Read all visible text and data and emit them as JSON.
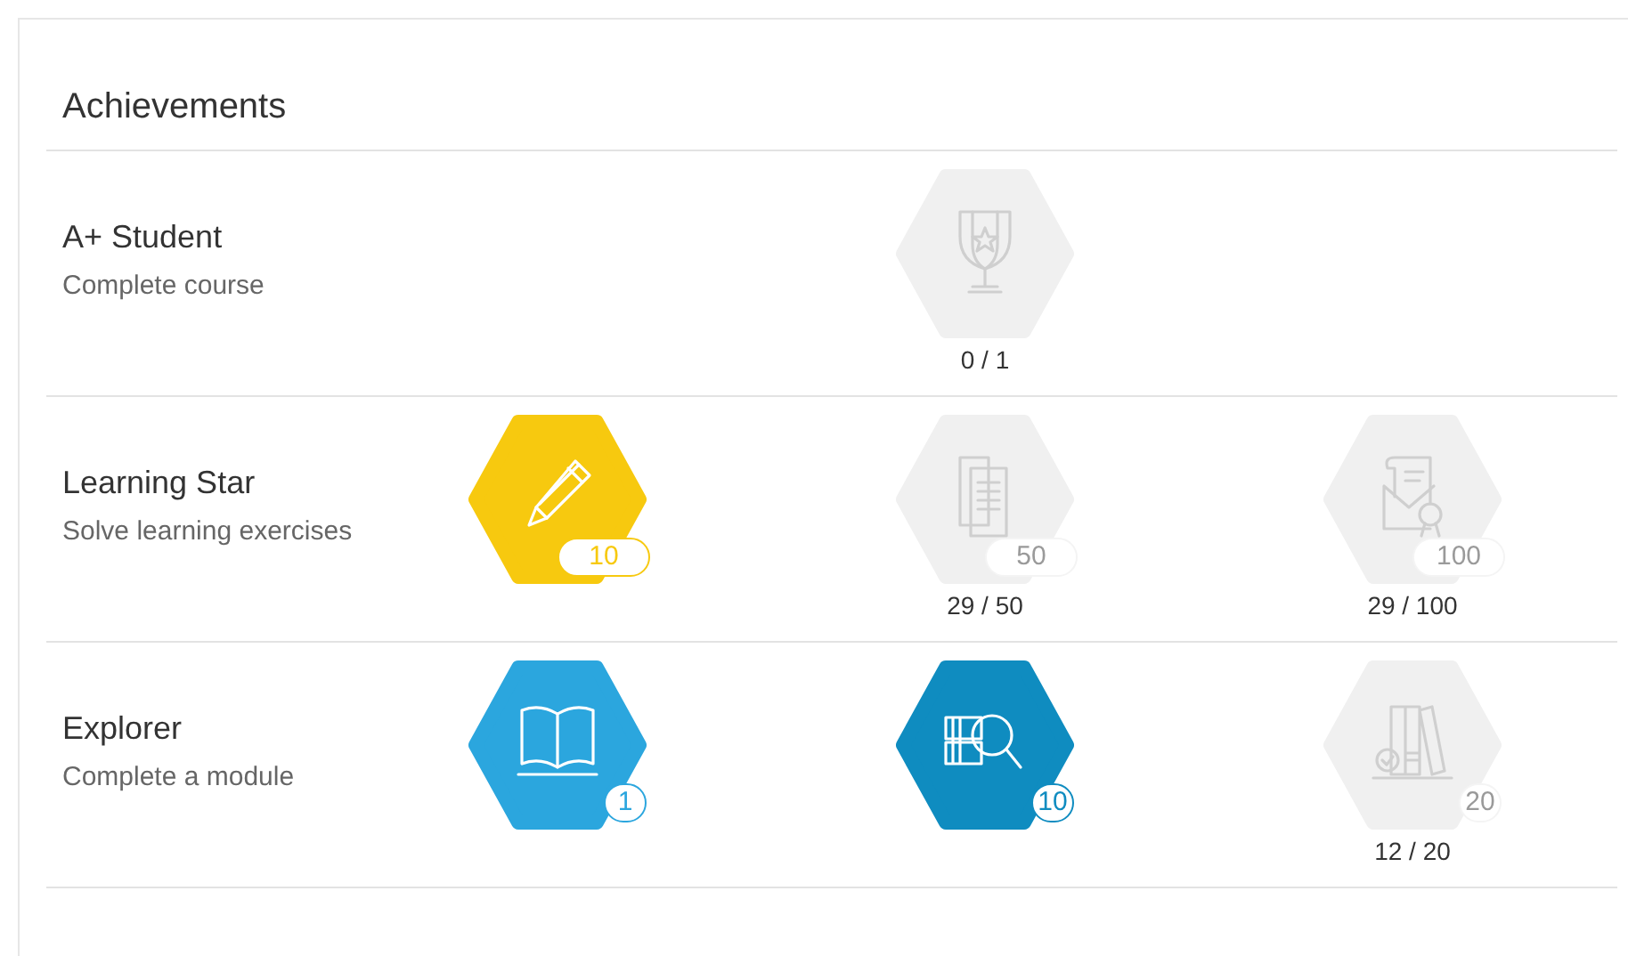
{
  "title": "Achievements",
  "achievements": [
    {
      "name": "A+ Student",
      "description": "Complete course",
      "slots": [
        {
          "kind": "empty"
        },
        {
          "kind": "badge",
          "earned": false,
          "progress": "0 / 1"
        },
        {
          "kind": "empty"
        }
      ]
    },
    {
      "name": "Learning Star",
      "description": "Solve learning exercises",
      "slots": [
        {
          "kind": "badge",
          "earned": true,
          "color": "#f7c90f",
          "threshold": "10"
        },
        {
          "kind": "badge",
          "earned": false,
          "threshold": "50",
          "progress": "29 / 50"
        },
        {
          "kind": "badge",
          "earned": false,
          "threshold": "100",
          "progress": "29 / 100"
        }
      ]
    },
    {
      "name": "Explorer",
      "description": "Complete a module",
      "slots": [
        {
          "kind": "badge",
          "earned": true,
          "color": "#2ba6de",
          "threshold": "1"
        },
        {
          "kind": "badge",
          "earned": true,
          "color": "#0f8cc0",
          "threshold": "10"
        },
        {
          "kind": "badge",
          "earned": false,
          "threshold": "20",
          "progress": "12 / 20"
        }
      ]
    }
  ]
}
